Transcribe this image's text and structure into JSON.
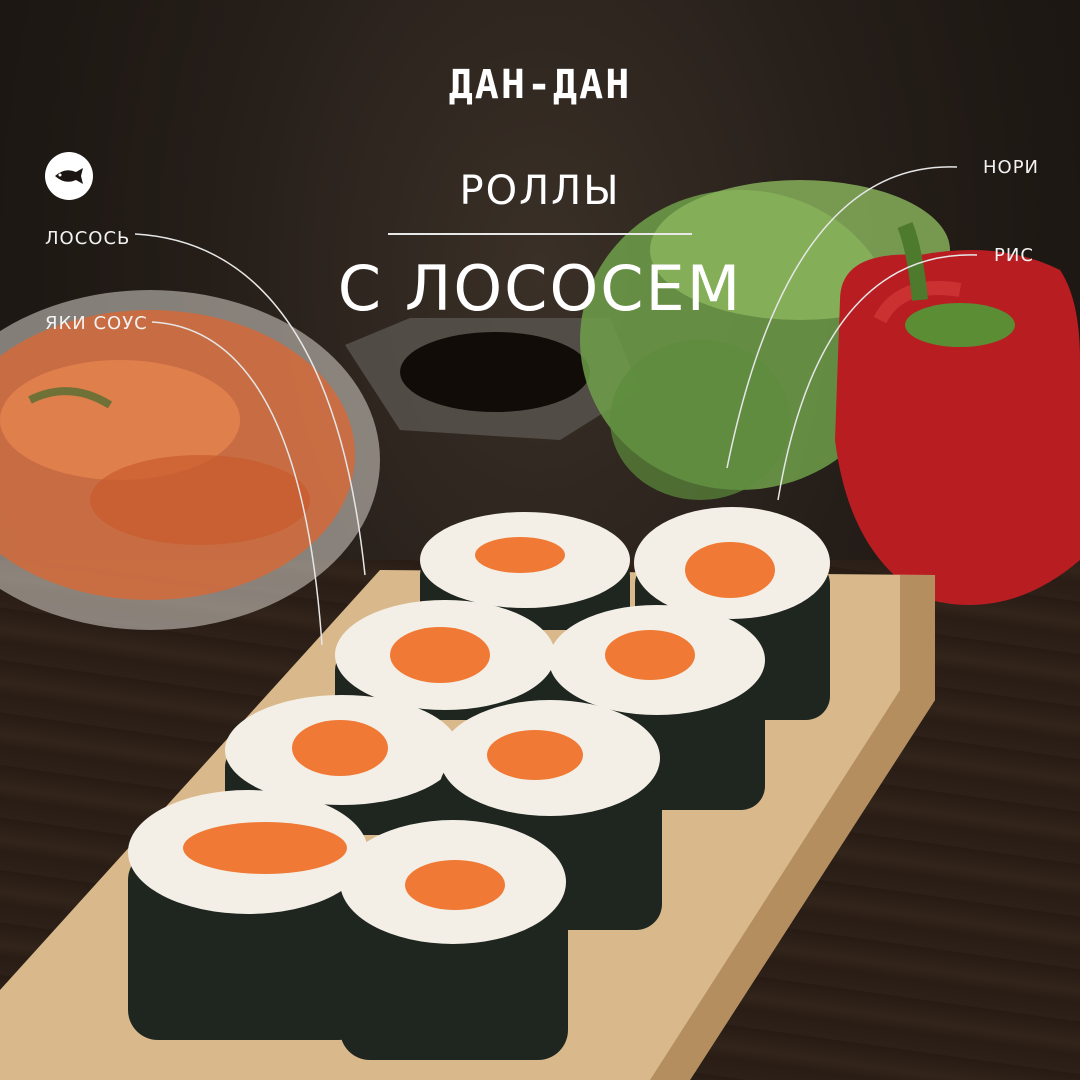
{
  "brand": {
    "logo_text": "ДАН-ДАН"
  },
  "title": {
    "line1": "РОЛЛЫ",
    "line2": "С ЛОСОСЕМ"
  },
  "labels": {
    "salmon": "ЛОСОСЬ",
    "yaki_sauce": "ЯКИ СОУС",
    "nori": "НОРИ",
    "rice": "РИС"
  },
  "icons": {
    "fish": "fish-icon"
  },
  "colors": {
    "accent_red": "#e0242e",
    "salmon": "#f07a35",
    "rice": "#f3efe6",
    "nori": "#1f2620"
  }
}
